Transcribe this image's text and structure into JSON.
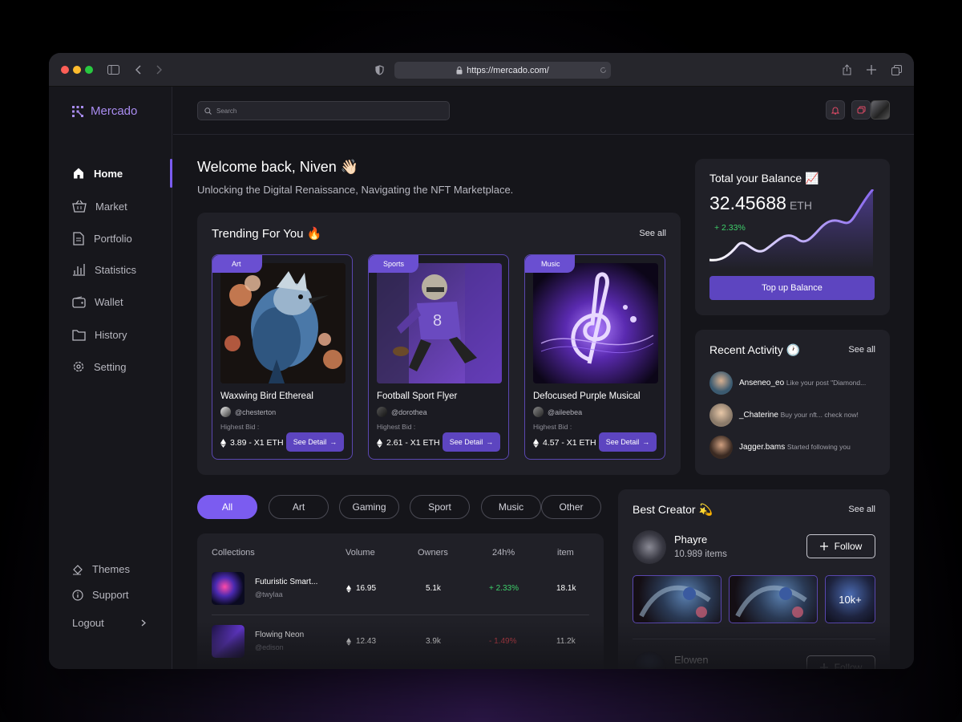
{
  "browser": {
    "url": "https://mercado.com/",
    "traffic_colors": [
      "#ff5f57",
      "#febc2e",
      "#28c840"
    ]
  },
  "app": {
    "brand": "Mercado",
    "accent": "#7b5cf0"
  },
  "sidebar": {
    "items": [
      {
        "label": "Home",
        "icon": "home-icon",
        "active": true
      },
      {
        "label": "Market",
        "icon": "basket-icon"
      },
      {
        "label": "Portfolio",
        "icon": "document-icon"
      },
      {
        "label": "Statistics",
        "icon": "bar-chart-icon"
      },
      {
        "label": "Wallet",
        "icon": "wallet-icon"
      },
      {
        "label": "History",
        "icon": "folder-icon"
      },
      {
        "label": "Setting",
        "icon": "gear-icon"
      }
    ],
    "bottom": [
      {
        "label": "Themes",
        "icon": "paint-bucket-icon"
      },
      {
        "label": "Support",
        "icon": "info-icon"
      },
      {
        "label": "Logout",
        "icon": "chevron-right-icon"
      }
    ]
  },
  "search": {
    "placeholder": "Search"
  },
  "welcome": {
    "title": "Welcome back, Niven 👋🏻",
    "subtitle": "Unlocking the Digital Renaissance, Navigating the NFT Marketplace."
  },
  "trending": {
    "title": "Trending For You 🔥",
    "see_all": "See all",
    "bid_label": "Highest Bid :",
    "button_label": "See Detail",
    "cards": [
      {
        "tag": "Art",
        "title": "Waxwing Bird Ethereal",
        "user": "@chesterton",
        "price": "3.89 - X1 ETH"
      },
      {
        "tag": "Sports",
        "title": "Football Sport Flyer",
        "user": "@dorothea",
        "price": "2.61 - X1 ETH"
      },
      {
        "tag": "Music",
        "title": "Defocused Purple Musical",
        "user": "@aileebea",
        "price": "4.57 - X1 ETH"
      }
    ]
  },
  "balance": {
    "title": "Total your Balance 📈",
    "amount": "32.45688",
    "unit": "ETH",
    "change": "+ 2.33%",
    "button": "Top up Balance"
  },
  "activity": {
    "title": "Recent Activity 🕐",
    "see_all": "See all",
    "items": [
      {
        "name": "Anseneo_eo",
        "text": "Like your post \"Diamond...",
        "color": "#3b5a70"
      },
      {
        "name": "_Chaterine",
        "text": "Buy your nft... check now!",
        "color": "#8a7a6a"
      },
      {
        "name": "Jagger.bams",
        "text": "Started following you",
        "color": "#6b4a3a"
      }
    ]
  },
  "filters": [
    "All",
    "Art",
    "Gaming",
    "Sport",
    "Music",
    "Other"
  ],
  "collections": {
    "headers": [
      "Collections",
      "Volume",
      "Owners",
      "24h%",
      "item"
    ],
    "rows": [
      {
        "name": "Futuristic Smart...",
        "user": "@twylaa",
        "volume": "16.95",
        "owners": "5.1k",
        "change": "+ 2.33%",
        "change_color": "#3ed16b",
        "items": "18.1k"
      },
      {
        "name": "Flowing Neon",
        "user": "@edison",
        "volume": "12.43",
        "owners": "3.9k",
        "change": "- 1.49%",
        "change_color": "#e0454f",
        "items": "11.2k"
      }
    ]
  },
  "creators": {
    "title": "Best Creator 💫",
    "see_all": "See all",
    "list": [
      {
        "name": "Phayre",
        "items": "10.989 items",
        "follow": "Follow",
        "more": "10k+"
      },
      {
        "name": "Elowen",
        "follow": "Follow"
      }
    ]
  }
}
